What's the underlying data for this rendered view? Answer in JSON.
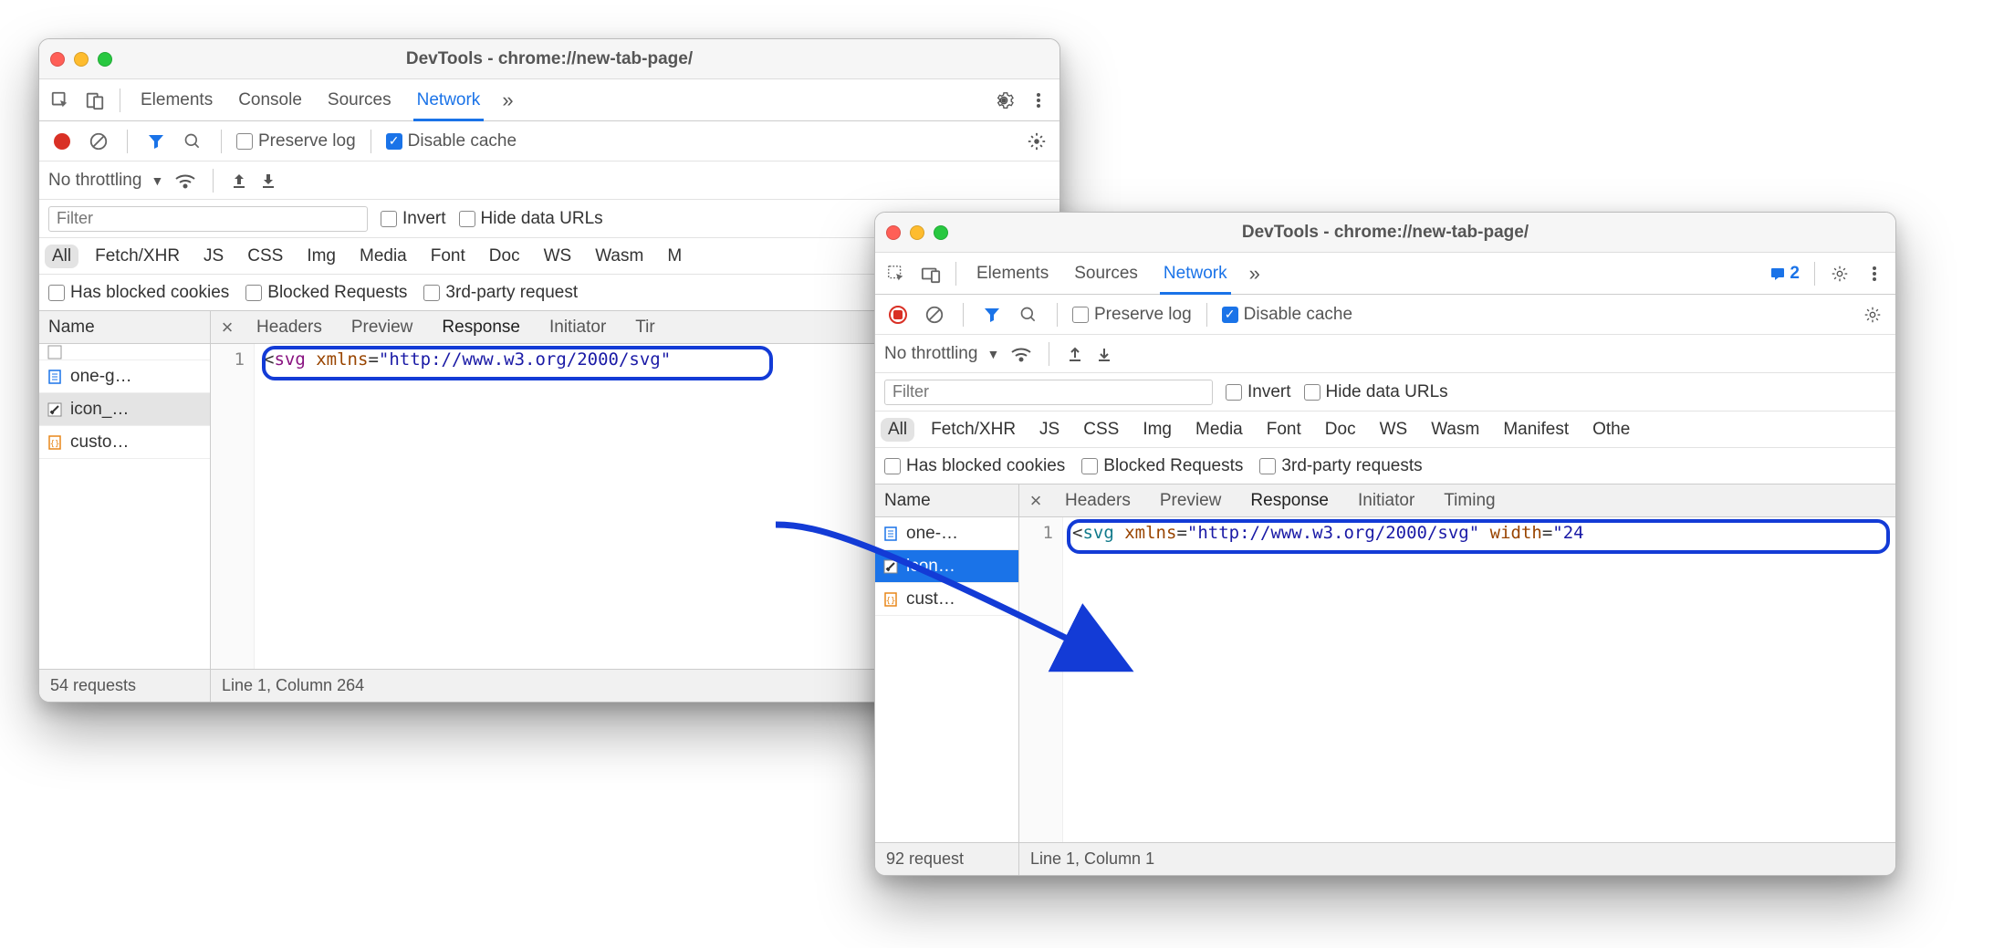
{
  "window_title": "DevTools - chrome://new-tab-page/",
  "tabs": {
    "elements": "Elements",
    "console": "Console",
    "sources": "Sources",
    "network": "Network"
  },
  "toolbar": {
    "preserve_log": "Preserve log",
    "disable_cache": "Disable cache"
  },
  "throttle": {
    "label": "No throttling"
  },
  "filter": {
    "placeholder": "Filter",
    "invert": "Invert",
    "hide_data_urls": "Hide data URLs"
  },
  "types": {
    "all": "All",
    "fetch": "Fetch/XHR",
    "js": "JS",
    "css": "CSS",
    "img": "Img",
    "media": "Media",
    "font": "Font",
    "doc": "Doc",
    "ws": "WS",
    "wasm": "Wasm",
    "manifest": "Manifest",
    "other": "Othe",
    "m_short": "M"
  },
  "extra": {
    "blocked_cookies": "Has blocked cookies",
    "blocked_requests": "Blocked Requests",
    "third_party": "3rd-party requests",
    "third_party_trunc": "3rd-party request"
  },
  "grid": {
    "name_header": "Name",
    "detail_tabs": {
      "headers": "Headers",
      "preview": "Preview",
      "response": "Response",
      "initiator": "Initiator",
      "timing": "Timing",
      "timing_trunc": "Tir"
    }
  },
  "left": {
    "rows": [
      "one-g…",
      "icon_…",
      "custo…"
    ],
    "status_left": "54 requests",
    "status_right": "Line 1, Column 264",
    "code_tag": "svg",
    "code_attr": "xmlns",
    "code_val": "\"http://www.w3.org/2000/svg\"",
    "gutter": "1"
  },
  "right": {
    "badge_count": "2",
    "rows": [
      "one-…",
      "icon…",
      "cust…"
    ],
    "status_left": "92 request",
    "status_right": "Line 1, Column 1",
    "code_tag": "svg",
    "code_attr1": "xmlns",
    "code_val1": "\"http://www.w3.org/2000/svg\"",
    "code_attr2": "width",
    "code_val2": "\"24",
    "gutter": "1"
  }
}
